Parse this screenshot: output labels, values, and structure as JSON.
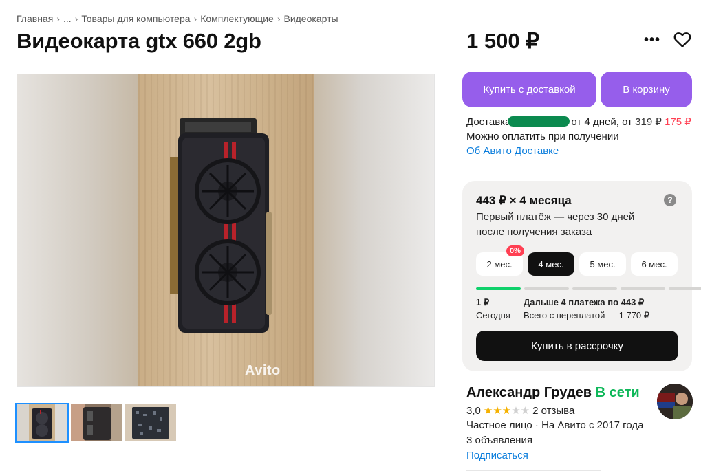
{
  "breadcrumb": {
    "items": [
      "Главная",
      "...",
      "Товары для компьютера",
      "Комплектующие",
      "Видеокарты"
    ],
    "separator": "›"
  },
  "listing": {
    "title": "Видеокарта gtx 660 2gb",
    "price": "1 500 ₽",
    "more_label": "•••",
    "favorite_icon": "heart-outline-icon"
  },
  "photo": {
    "watermark": "Avito",
    "thumbnail_count": 3,
    "active_thumbnail": 0
  },
  "actions": {
    "buy_with_delivery": "Купить с доставкой",
    "add_to_cart": "В корзину"
  },
  "delivery": {
    "label": "Доставка",
    "days": "от 4 дней, от",
    "old_price": "319 ₽",
    "new_price": "175 ₽",
    "pay_on_receipt": "Можно оплатить при получении",
    "about_link": "Об Авито Доставке"
  },
  "installment": {
    "title": "443 ₽ × 4 месяца",
    "description": "Первый платёж — через 30 дней после получения заказа",
    "help_icon": "question-icon",
    "help_label": "?",
    "terms": [
      "2 мес.",
      "4 мес.",
      "5 мес.",
      "6 мес."
    ],
    "selected_term": 1,
    "zero_badge": "0%",
    "first_payment_amount": "1 ₽",
    "first_payment_when": "Сегодня",
    "rest_label": "Дальше 4 платежа по 443 ₽",
    "total_label": "Всего с переплатой — 1 770 ₽",
    "button": "Купить в рассрочку",
    "progress_done_fraction": 0.2
  },
  "seller": {
    "name": "Александр Грудев",
    "status": "В сети",
    "rating": "3,0",
    "stars": 3,
    "reviews": "2 отзыва",
    "type": "Частное лицо · На Авито с 2017 года",
    "listings": "3 объявления",
    "subscribe": "Подписаться"
  },
  "colors": {
    "primary_purple": "#965eeb",
    "link_blue": "#0a7ddc",
    "online_green": "#0fb85a",
    "sale_red": "#ff4053",
    "progress_green": "#0fd16b",
    "star_yellow": "#f5b100"
  }
}
